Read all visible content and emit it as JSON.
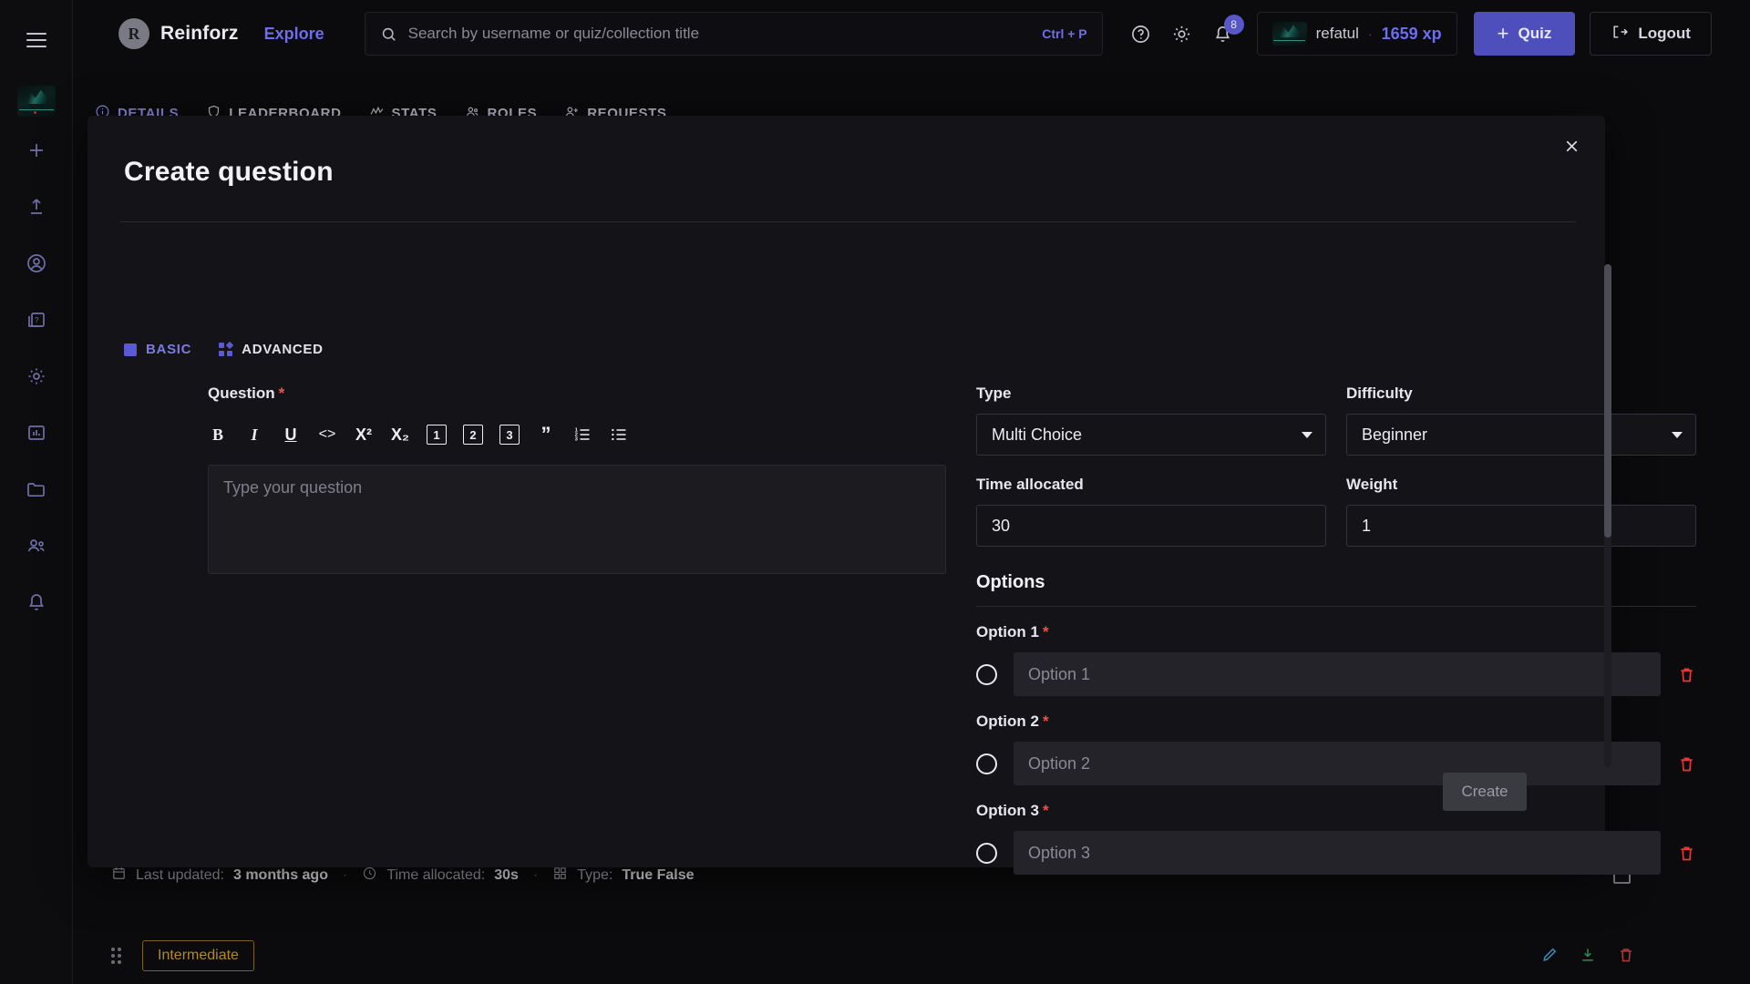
{
  "sidebar": {
    "menu_icon": "hamburger-icon",
    "avatar": "user-avatar-thumbnail",
    "items": [
      {
        "icon": "plus-icon",
        "label": "Create"
      },
      {
        "icon": "upload-icon",
        "label": "Upload"
      },
      {
        "icon": "user-circle-icon",
        "label": "Profile"
      },
      {
        "icon": "quiz-card-icon",
        "label": "Quizzes"
      },
      {
        "icon": "gear-icon",
        "label": "Settings"
      },
      {
        "icon": "chart-bar-icon",
        "label": "Stats"
      },
      {
        "icon": "folder-icon",
        "label": "Collections"
      },
      {
        "icon": "users-icon",
        "label": "Groups"
      },
      {
        "icon": "bell-icon",
        "label": "Notifications"
      }
    ]
  },
  "header": {
    "brand_mark": "R",
    "brand_name": "Reinforz",
    "explore_label": "Explore",
    "search": {
      "placeholder": "Search by username or quiz/collection title",
      "value": "",
      "shortcut": "Ctrl + P",
      "icon": "search-icon"
    },
    "help_icon": "help-circle-icon",
    "theme_icon": "sun-icon",
    "notification_icon": "bell-icon",
    "notification_count": "8",
    "user": {
      "name": "refatul",
      "separator": "·",
      "xp": "1659 xp"
    },
    "quiz_button": {
      "label": "Quiz",
      "plus": "+"
    },
    "logout_button": {
      "label": "Logout",
      "icon": "logout-icon"
    }
  },
  "page_tabs": [
    {
      "label": "DETAILS",
      "icon": "info-icon",
      "active": true
    },
    {
      "label": "LEADERBOARD",
      "icon": "shield-icon",
      "active": false
    },
    {
      "label": "STATS",
      "icon": "activity-icon",
      "active": false
    },
    {
      "label": "ROLES",
      "icon": "users-icon",
      "active": false
    },
    {
      "label": "REQUESTS",
      "icon": "user-plus-icon",
      "active": false
    }
  ],
  "modal": {
    "title": "Create question",
    "close_icon": "close-icon",
    "tabs": [
      {
        "label": "BASIC",
        "icon": "square-icon",
        "active": true
      },
      {
        "label": "ADVANCED",
        "icon": "four-squares-icon",
        "active": false
      }
    ],
    "question": {
      "label": "Question",
      "required_mark": "*",
      "placeholder": "Type your question",
      "value": "",
      "toolbar": [
        {
          "name": "bold-button",
          "glyph": "B"
        },
        {
          "name": "italic-button",
          "glyph": "I"
        },
        {
          "name": "underline-button",
          "glyph": "U"
        },
        {
          "name": "code-button",
          "glyph": "<>"
        },
        {
          "name": "superscript-button",
          "glyph": "X²"
        },
        {
          "name": "subscript-button",
          "glyph": "X₂"
        },
        {
          "name": "heading-1-button",
          "glyph": "1"
        },
        {
          "name": "heading-2-button",
          "glyph": "2"
        },
        {
          "name": "heading-3-button",
          "glyph": "3"
        },
        {
          "name": "blockquote-button",
          "glyph": "”"
        },
        {
          "name": "ordered-list-button",
          "glyph": "ol"
        },
        {
          "name": "bullet-list-button",
          "glyph": "ul"
        }
      ]
    },
    "type_field": {
      "label": "Type",
      "value": "Multi Choice"
    },
    "difficulty_field": {
      "label": "Difficulty",
      "value": "Beginner"
    },
    "time_field": {
      "label": "Time allocated",
      "value": "30"
    },
    "weight_field": {
      "label": "Weight",
      "value": "1"
    },
    "options_heading": "Options",
    "options": [
      {
        "label": "Option 1",
        "required_mark": "*",
        "placeholder": "Option 1",
        "value": "",
        "selected": false
      },
      {
        "label": "Option 2",
        "required_mark": "*",
        "placeholder": "Option 2",
        "value": "",
        "selected": false
      },
      {
        "label": "Option 3",
        "required_mark": "*",
        "placeholder": "Option 3",
        "value": "",
        "selected": false
      }
    ],
    "delete_option_icon": "trash-icon",
    "create_button": "Create"
  },
  "footer": {
    "last_updated_label": "Last updated:",
    "last_updated_value": "3 months ago",
    "time_allocated_label": "Time allocated:",
    "time_allocated_value": "30s",
    "type_label": "Type:",
    "type_value": "True False",
    "separator": "·",
    "level_chip": "Intermediate",
    "actions": [
      {
        "name": "edit-icon",
        "color": "#3a8fbf"
      },
      {
        "name": "download-icon",
        "color": "#2e8b4e"
      },
      {
        "name": "trash-icon",
        "color": "#b23a3a"
      }
    ]
  }
}
